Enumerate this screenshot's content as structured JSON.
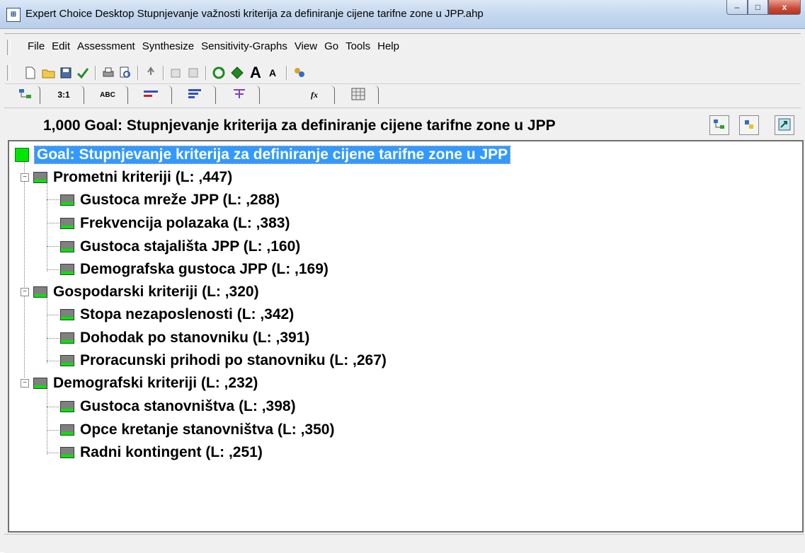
{
  "window": {
    "title": "Expert Choice Desktop    Stupnjevanje važnosti kriterija za definiranje cijene tarifne zone u JPP.ahp",
    "app_icon": "expert-choice-icon",
    "controls": {
      "minimize": "–",
      "maximize": "□",
      "close": "x"
    }
  },
  "menu": {
    "items": [
      "File",
      "Edit",
      "Assessment",
      "Synthesize",
      "Sensitivity-Graphs",
      "View",
      "Go",
      "Tools",
      "Help"
    ]
  },
  "toolbar": {
    "icons": [
      "new-file-icon",
      "open-folder-icon",
      "save-icon",
      "checkmark-icon",
      "print-icon",
      "print-preview-icon",
      "cut-icon",
      "copy-icon",
      "paste-icon",
      "recalculate-icon",
      "recalculate-all-icon",
      "font-larger-icon",
      "font-smaller-icon",
      "participants-icon"
    ],
    "font_larger": "A",
    "font_smaller": "A"
  },
  "tabs": {
    "items": [
      "",
      "3:1",
      "ABC",
      "",
      "",
      "",
      "fx",
      ""
    ],
    "icons": [
      "tree-view-icon",
      "pairwise-numeric-icon",
      "verbal-icon",
      "graphical-icon",
      "bar-icon",
      "questionnaire-icon",
      "formula-icon",
      "data-grid-icon"
    ]
  },
  "header": {
    "text": "1,000  Goal: Stupnjevanje kriterija za definiranje cijene tarifne zone u JPP",
    "buttons": [
      "tree-view-icon",
      "alternatives-icon",
      "expand-icon"
    ]
  },
  "tree": {
    "goal": "Goal: Stupnjevanje kriterija za definiranje cijene tarifne zone u JPP",
    "groups": [
      {
        "label": "Prometni kriteriji (L: ,447)",
        "children": [
          "Gustoca mreže JPP (L: ,288)",
          "Frekvencija polazaka (L: ,383)",
          "Gustoca stajališta JPP (L: ,160)",
          "Demografska gustoca JPP (L: ,169)"
        ]
      },
      {
        "label": "Gospodarski kriteriji (L: ,320)",
        "children": [
          "Stopa nezaposlenosti (L: ,342)",
          "Dohodak po stanovniku (L: ,391)",
          "Proracunski prihodi po stanovniku (L: ,267)"
        ]
      },
      {
        "label": "Demografski kriteriji (L: ,232)",
        "children": [
          "Gustoca stanovništva (L: ,398)",
          "Opce kretanje stanovništva (L: ,350)",
          "Radni kontingent (L: ,251)"
        ]
      }
    ]
  },
  "colors": {
    "priority_green": "#00e600",
    "node_gray": "#808080",
    "selection_blue": "#3399ff"
  }
}
